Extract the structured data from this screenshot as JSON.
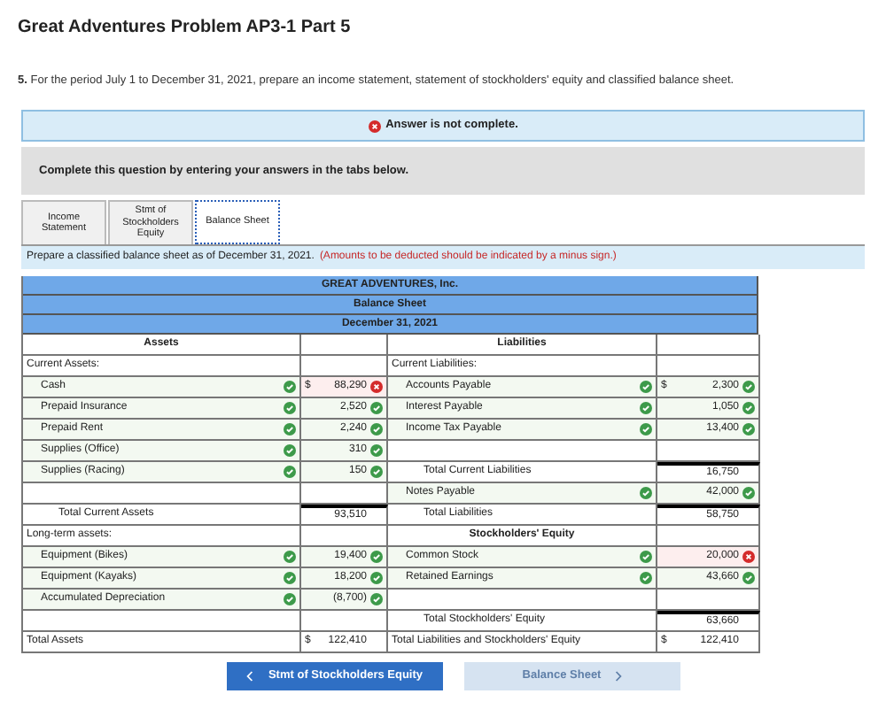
{
  "title": "Great Adventures Problem AP3-1 Part 5",
  "question": {
    "number": "5.",
    "text": "For the period July 1 to December 31, 2021, prepare an income statement, statement of stockholders' equity and classified balance sheet."
  },
  "alert": {
    "text": "Answer is not complete."
  },
  "instruction": "Complete this question by entering your answers in the tabs below.",
  "tabs": [
    {
      "label": "Income Statement",
      "selected": false
    },
    {
      "label": "Stmt of Stockholders Equity",
      "selected": false
    },
    {
      "label": "Balance Sheet",
      "selected": true
    }
  ],
  "prompt": {
    "text": "Prepare a classified balance sheet as of December 31, 2021.",
    "note": "(Amounts to be deducted should be indicated by a minus sign.)"
  },
  "statement_header": [
    "GREAT ADVENTURES, Inc.",
    "Balance Sheet",
    "December 31, 2021"
  ],
  "rows": [
    {
      "left": {
        "kind": "heading",
        "label": "Assets"
      },
      "right": {
        "kind": "heading",
        "label": "Liabilities"
      }
    },
    {
      "left": {
        "kind": "section",
        "label": "Current Assets:"
      },
      "right": {
        "kind": "section",
        "label": "Current Liabilities:"
      }
    },
    {
      "left": {
        "kind": "entry",
        "label": "Cash",
        "label_correct": true,
        "currency": "$",
        "amount": "88,290",
        "amount_correct": false
      },
      "right": {
        "kind": "entry",
        "label": "Accounts Payable",
        "label_correct": true,
        "currency": "$",
        "amount": "2,300",
        "amount_correct": true
      }
    },
    {
      "left": {
        "kind": "entry",
        "label": "Prepaid Insurance",
        "label_correct": true,
        "amount": "2,520",
        "amount_correct": true
      },
      "right": {
        "kind": "entry",
        "label": "Interest Payable",
        "label_correct": true,
        "amount": "1,050",
        "amount_correct": true
      }
    },
    {
      "left": {
        "kind": "entry",
        "label": "Prepaid Rent",
        "label_correct": true,
        "amount": "2,240",
        "amount_correct": true
      },
      "right": {
        "kind": "entry",
        "label": "Income Tax Payable",
        "label_correct": true,
        "amount": "13,400",
        "amount_correct": true
      }
    },
    {
      "left": {
        "kind": "entry",
        "label": "Supplies (Office)",
        "label_correct": true,
        "amount": "310",
        "amount_correct": true
      },
      "right": {
        "kind": "blank"
      }
    },
    {
      "left": {
        "kind": "entry",
        "label": "Supplies (Racing)",
        "label_correct": true,
        "amount": "150",
        "amount_correct": true
      },
      "right": {
        "kind": "subtotal",
        "label": "Total Current Liabilities",
        "amount": "16,750"
      }
    },
    {
      "left": {
        "kind": "blank"
      },
      "right": {
        "kind": "entry",
        "label": "Notes Payable",
        "label_correct": true,
        "amount": "42,000",
        "amount_correct": true
      }
    },
    {
      "left": {
        "kind": "subtotal",
        "label": "Total Current Assets",
        "amount": "93,510"
      },
      "right": {
        "kind": "subtotal",
        "label": "Total Liabilities",
        "amount": "58,750"
      }
    },
    {
      "left": {
        "kind": "section",
        "label": "Long-term assets:"
      },
      "right": {
        "kind": "heading",
        "label": "Stockholders' Equity"
      }
    },
    {
      "left": {
        "kind": "entry",
        "label": "Equipment (Bikes)",
        "label_correct": true,
        "amount": "19,400",
        "amount_correct": true
      },
      "right": {
        "kind": "entry",
        "label": "Common Stock",
        "label_correct": true,
        "amount": "20,000",
        "amount_correct": false
      }
    },
    {
      "left": {
        "kind": "entry",
        "label": "Equipment (Kayaks)",
        "label_correct": true,
        "amount": "18,200",
        "amount_correct": true
      },
      "right": {
        "kind": "entry",
        "label": "Retained Earnings",
        "label_correct": true,
        "amount": "43,660",
        "amount_correct": true
      }
    },
    {
      "left": {
        "kind": "entry",
        "label": "Accumulated Depreciation",
        "label_correct": true,
        "amount": "(8,700)",
        "amount_correct": true
      },
      "right": {
        "kind": "blank"
      }
    },
    {
      "left": {
        "kind": "blank"
      },
      "right": {
        "kind": "subtotal",
        "label": "Total Stockholders' Equity",
        "amount": "63,660"
      }
    },
    {
      "left": {
        "kind": "total",
        "label": "Total Assets",
        "currency": "$",
        "amount": "122,410"
      },
      "right": {
        "kind": "total",
        "label": "Total Liabilities and Stockholders' Equity",
        "currency": "$",
        "amount": "122,410"
      }
    }
  ],
  "nav": [
    {
      "kind": "prev",
      "label": "Stmt of Stockholders Equity",
      "disabled": false
    },
    {
      "kind": "next",
      "label": "Balance Sheet",
      "disabled": true
    }
  ]
}
